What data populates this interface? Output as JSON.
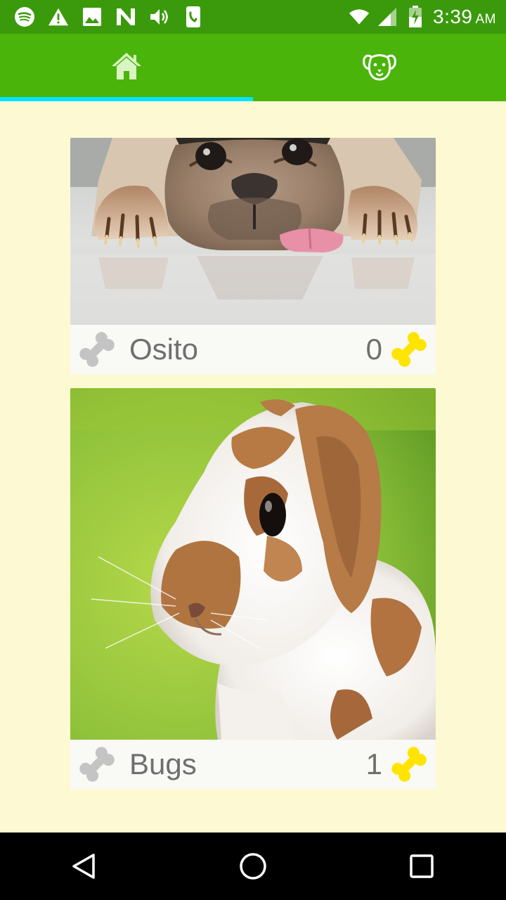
{
  "status_bar": {
    "time": "3:39",
    "ampm": "AM",
    "left_icons": [
      "spotify-icon",
      "warning-icon",
      "image-icon",
      "n-app-icon",
      "volume-icon",
      "phone-clipboard-icon"
    ],
    "right_icons": [
      "wifi-icon",
      "cell-signal-icon",
      "battery-charging-icon"
    ]
  },
  "tabs": [
    {
      "name": "tab-home",
      "icon": "home-icon",
      "selected": true
    },
    {
      "name": "tab-pet",
      "icon": "dog-face-icon",
      "selected": false
    }
  ],
  "pets": [
    {
      "name": "Osito",
      "count": "0",
      "photo": "pug"
    },
    {
      "name": "Bugs",
      "count": "1",
      "photo": "rabbit"
    }
  ],
  "colors": {
    "status_bar": "#3a9a0b",
    "app_bar": "#4ab40b",
    "tab_indicator": "#00e5ff",
    "background": "#fdf9d3",
    "bone_gray": "#c4c4c4",
    "bone_yellow": "#ffe400"
  },
  "nav": [
    "back-icon",
    "home-circle-icon",
    "recents-icon"
  ]
}
